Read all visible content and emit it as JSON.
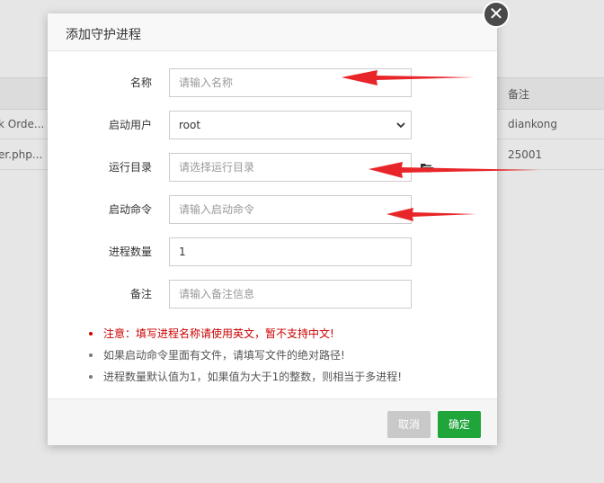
{
  "background": {
    "table_header": {
      "col_remark": "备注"
    },
    "rows": [
      {
        "left_text": "k Orde...",
        "remark": "diankong"
      },
      {
        "left_text": "er.php...",
        "remark": "25001"
      }
    ]
  },
  "dialog": {
    "title": "添加守护进程",
    "close_icon": "close-icon",
    "fields": {
      "name": {
        "label": "名称",
        "value": "",
        "placeholder": "请输入名称"
      },
      "user": {
        "label": "启动用户",
        "value": "root",
        "options": [
          "root"
        ]
      },
      "dir": {
        "label": "运行目录",
        "value": "",
        "placeholder": "请选择运行目录"
      },
      "command": {
        "label": "启动命令",
        "value": "",
        "placeholder": "请输入启动命令"
      },
      "count": {
        "label": "进程数量",
        "value": "1"
      },
      "remark": {
        "label": "备注",
        "value": "",
        "placeholder": "请输入备注信息"
      }
    },
    "tips": [
      {
        "text": "注意：填写进程名称请使用英文，暂不支持中文!",
        "warn": true
      },
      {
        "text": "如果启动命令里面有文件，请填写文件的绝对路径!",
        "warn": false
      },
      {
        "text": "进程数量默认值为1，如果值为大于1的整数，则相当于多进程!",
        "warn": false
      }
    ],
    "buttons": {
      "cancel": "取消",
      "ok": "确定"
    }
  },
  "colors": {
    "ok_button": "#20a53a",
    "cancel_button": "#c9c9c9",
    "warning_text": "#cc0000",
    "annotation_arrow": "#e8262a"
  }
}
